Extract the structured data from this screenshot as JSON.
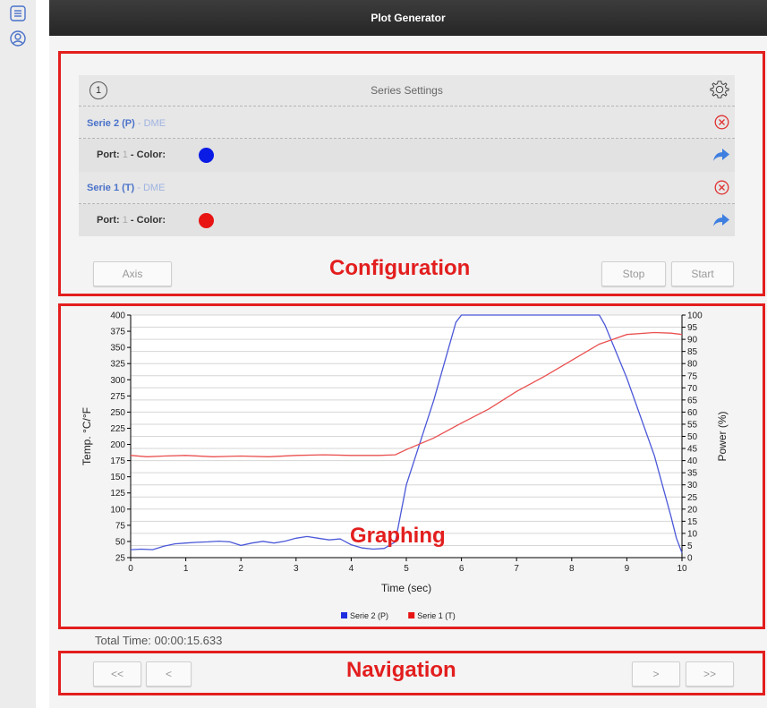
{
  "app": {
    "title": "Plot Generator"
  },
  "sidebar": {
    "items": [
      {
        "icon": "list-icon"
      },
      {
        "icon": "user-icon"
      }
    ]
  },
  "labels": {
    "configuration": "Configuration",
    "graphing": "Graphing",
    "navigation": "Navigation"
  },
  "series_settings": {
    "number": "1",
    "title": "Series Settings",
    "series": [
      {
        "name": "Serie 2 (P)",
        "sub": " - DME",
        "port_label": "Port:",
        "port": " 1 ",
        "color_label": "- Color:",
        "color": "#0b1be6"
      },
      {
        "name": "Serie 1 (T)",
        "sub": " - DME",
        "port_label": "Port:",
        "port": " 1 ",
        "color_label": "- Color:",
        "color": "#e81414"
      }
    ]
  },
  "buttons": {
    "axis": "Axis",
    "stop": "Stop",
    "start": "Start"
  },
  "total_time": "Total Time: 00:00:15.633",
  "nav": {
    "first": "<<",
    "prev": "<",
    "next": ">",
    "last": ">>"
  },
  "chart_data": {
    "type": "line",
    "xlabel": "Time (sec)",
    "ylabel": "Temp. °C/°F",
    "y2label": "Power (%)",
    "xlim": [
      0,
      10
    ],
    "ylim": [
      25,
      400
    ],
    "y2lim": [
      0,
      100
    ],
    "xticks": [
      0,
      1,
      2,
      3,
      4,
      5,
      6,
      7,
      8,
      9,
      10
    ],
    "yticks": [
      25,
      50,
      75,
      100,
      125,
      150,
      175,
      200,
      225,
      250,
      275,
      300,
      325,
      350,
      375,
      400
    ],
    "y2ticks": [
      0,
      5,
      10,
      15,
      20,
      25,
      30,
      35,
      40,
      45,
      50,
      55,
      60,
      65,
      70,
      75,
      80,
      85,
      90,
      95,
      100
    ],
    "legend_position": "bottom",
    "series": [
      {
        "name": "Serie 2 (P)",
        "color": "#4b58d8",
        "axis": "right",
        "x": [
          0,
          0.2,
          0.4,
          0.6,
          0.8,
          1.0,
          1.2,
          1.4,
          1.6,
          1.8,
          2.0,
          2.2,
          2.4,
          2.6,
          2.8,
          3.0,
          3.2,
          3.4,
          3.6,
          3.8,
          4.0,
          4.2,
          4.4,
          4.6,
          4.8,
          5.0,
          5.5,
          5.9,
          6.0,
          7.0,
          8.0,
          8.5,
          8.6,
          9.0,
          9.5,
          9.8,
          9.9,
          10.0
        ],
        "values": [
          3.3,
          3.5,
          3.3,
          4.7,
          5.7,
          6.0,
          6.3,
          6.5,
          6.8,
          6.5,
          5.0,
          6.0,
          6.7,
          6.0,
          6.8,
          8.0,
          8.7,
          8.0,
          7.3,
          7.7,
          5.3,
          4.0,
          3.5,
          3.8,
          6.5,
          30,
          65,
          97,
          100,
          100,
          100,
          100,
          96,
          74,
          42,
          17,
          8,
          2
        ]
      },
      {
        "name": "Serie 1 (T)",
        "color": "#ea5050",
        "axis": "left",
        "x": [
          0,
          0.3,
          0.6,
          1.0,
          1.5,
          2.0,
          2.5,
          3.0,
          3.5,
          4.0,
          4.5,
          4.8,
          5.0,
          5.5,
          6.0,
          6.5,
          7.0,
          7.5,
          8.0,
          8.5,
          9.0,
          9.5,
          9.8,
          10.0
        ],
        "values": [
          183,
          181,
          182,
          183,
          181,
          182,
          181,
          183,
          184,
          183,
          183,
          184,
          192,
          210,
          233,
          255,
          282,
          305,
          330,
          355,
          370,
          373,
          372,
          370
        ]
      }
    ]
  }
}
